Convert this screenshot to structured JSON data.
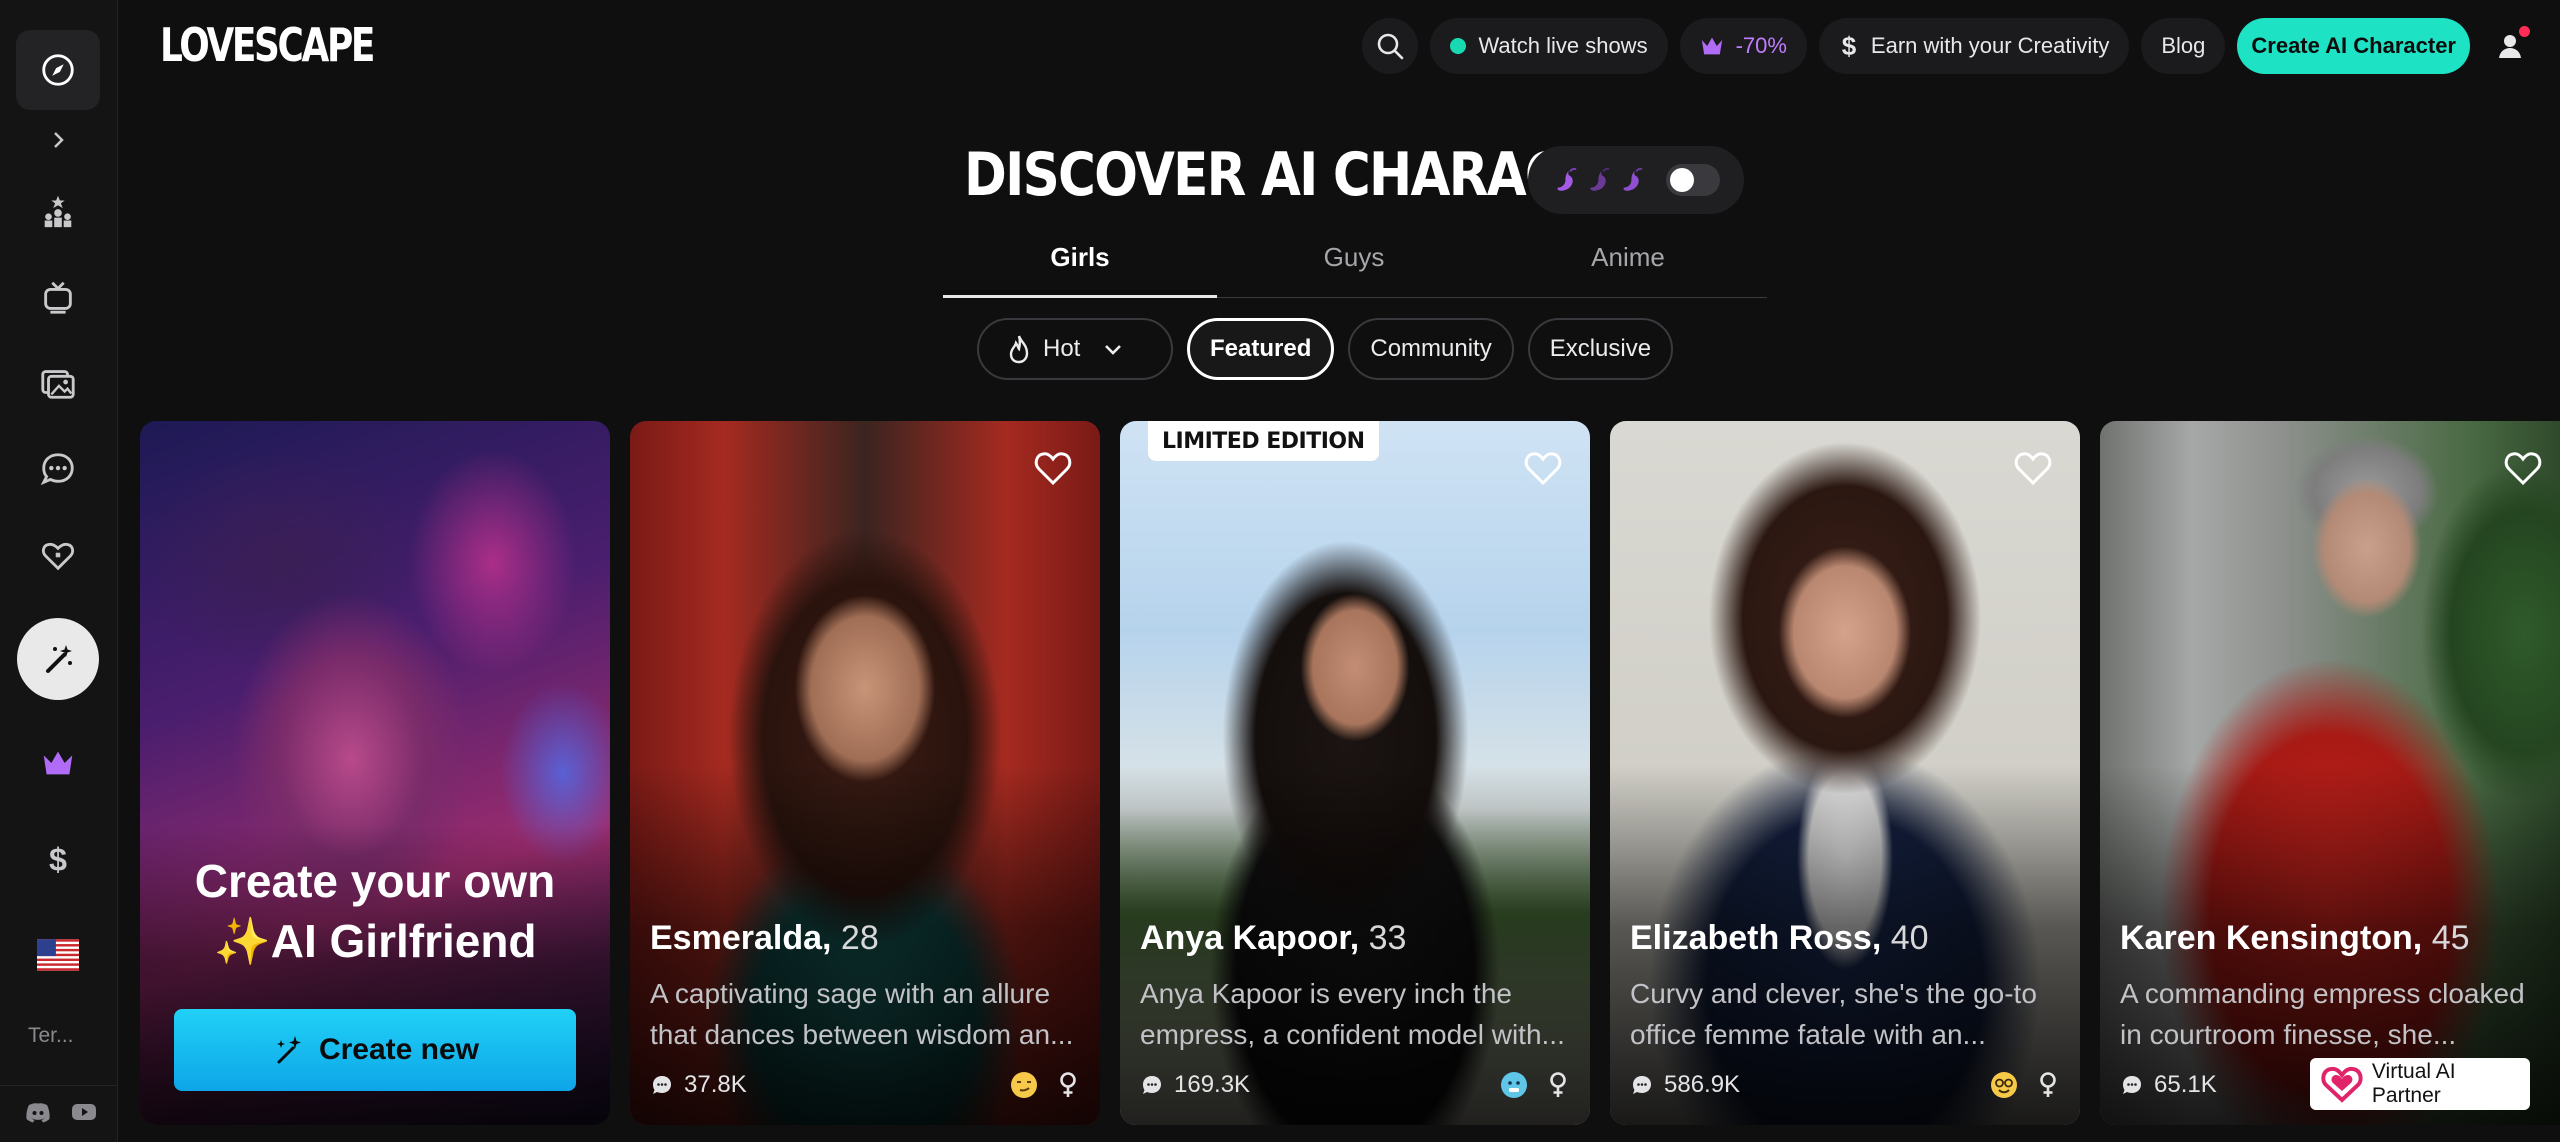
{
  "app": {
    "logo": "LOVESCAPE"
  },
  "sidebar": {
    "items": [
      {
        "name": "compass"
      },
      {
        "name": "chevron-right"
      },
      {
        "name": "leaderboard"
      },
      {
        "name": "tv"
      },
      {
        "name": "gallery"
      },
      {
        "name": "chat"
      },
      {
        "name": "heart-tag"
      },
      {
        "name": "magic-wand"
      },
      {
        "name": "crown"
      },
      {
        "name": "dollar"
      },
      {
        "name": "us-flag"
      }
    ],
    "terms_label": "Ter..."
  },
  "topbar": {
    "live_label": "Watch live shows",
    "discount_label": "-70%",
    "earn_label": "Earn with your Creativity",
    "blog_label": "Blog",
    "create_label": "Create AI Character"
  },
  "discover": {
    "title": "DISCOVER AI CHARACTERS",
    "tabs": [
      "Girls",
      "Guys",
      "Anime"
    ],
    "filters": {
      "hot": "Hot",
      "featured": "Featured",
      "community": "Community",
      "exclusive": "Exclusive"
    }
  },
  "promo": {
    "line1": "Create your own",
    "line2": "✨AI Girlfriend",
    "button": "Create new"
  },
  "cards": [
    {
      "name": "Esmeralda,",
      "age": "28",
      "desc1": "A captivating sage with an allure",
      "desc2": "that dances between wisdom an...",
      "chats": "37.8K"
    },
    {
      "name": "Anya Kapoor,",
      "age": "33",
      "desc1": "Anya Kapoor is every inch the",
      "desc2": "empress, a confident model with...",
      "chats": "169.3K",
      "badge": "LIMITED EDITION"
    },
    {
      "name": "Elizabeth Ross,",
      "age": "40",
      "desc1": "Curvy and clever, she's the go-to",
      "desc2": "office femme fatale with an...",
      "chats": "586.9K"
    },
    {
      "name": "Karen Kensington,",
      "age": "45",
      "desc1": "A commanding empress cloaked",
      "desc2": "in courtroom finesse, she...",
      "chats": "65.1K"
    }
  ],
  "badge_widget": {
    "label": "Virtual AI Partner"
  },
  "colors": {
    "accent": "#1de2c4",
    "live": "#18d9b2",
    "discount": "#c27cff",
    "promo_button": "#0ea5e8"
  }
}
